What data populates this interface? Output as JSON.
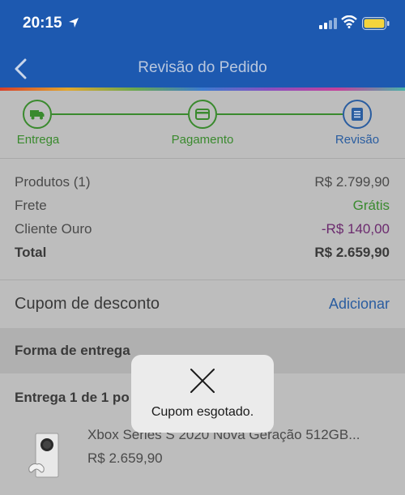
{
  "status_bar": {
    "time": "20:15"
  },
  "nav": {
    "title": "Revisão do Pedido"
  },
  "steps": [
    {
      "label": "Entrega",
      "color": "#3a8a2e"
    },
    {
      "label": "Pagamento",
      "color": "#3a8a2e"
    },
    {
      "label": "Revisão",
      "color": "#2a5da0"
    }
  ],
  "summary": {
    "products_label": "Produtos (1)",
    "products_value": "R$ 2.799,90",
    "shipping_label": "Frete",
    "shipping_value": "Grátis",
    "club_label": "Cliente Ouro",
    "club_value": "-R$ 140,00",
    "total_label": "Total",
    "total_value": "R$ 2.659,90"
  },
  "coupon": {
    "label": "Cupom de desconto",
    "action": "Adicionar"
  },
  "delivery_section": {
    "title": "Forma de entrega"
  },
  "delivery": {
    "title": "Entrega 1 de 1 po",
    "product_name": "Xbox Series S 2020 Nova Geração 512GB...",
    "product_price": "R$ 2.659,90"
  },
  "toast": {
    "message": "Cupom esgotado."
  },
  "colors": {
    "primary": "#1d59b0",
    "success": "#3a8a2e",
    "discount": "#6b2a6e",
    "link": "#2a5da0"
  }
}
